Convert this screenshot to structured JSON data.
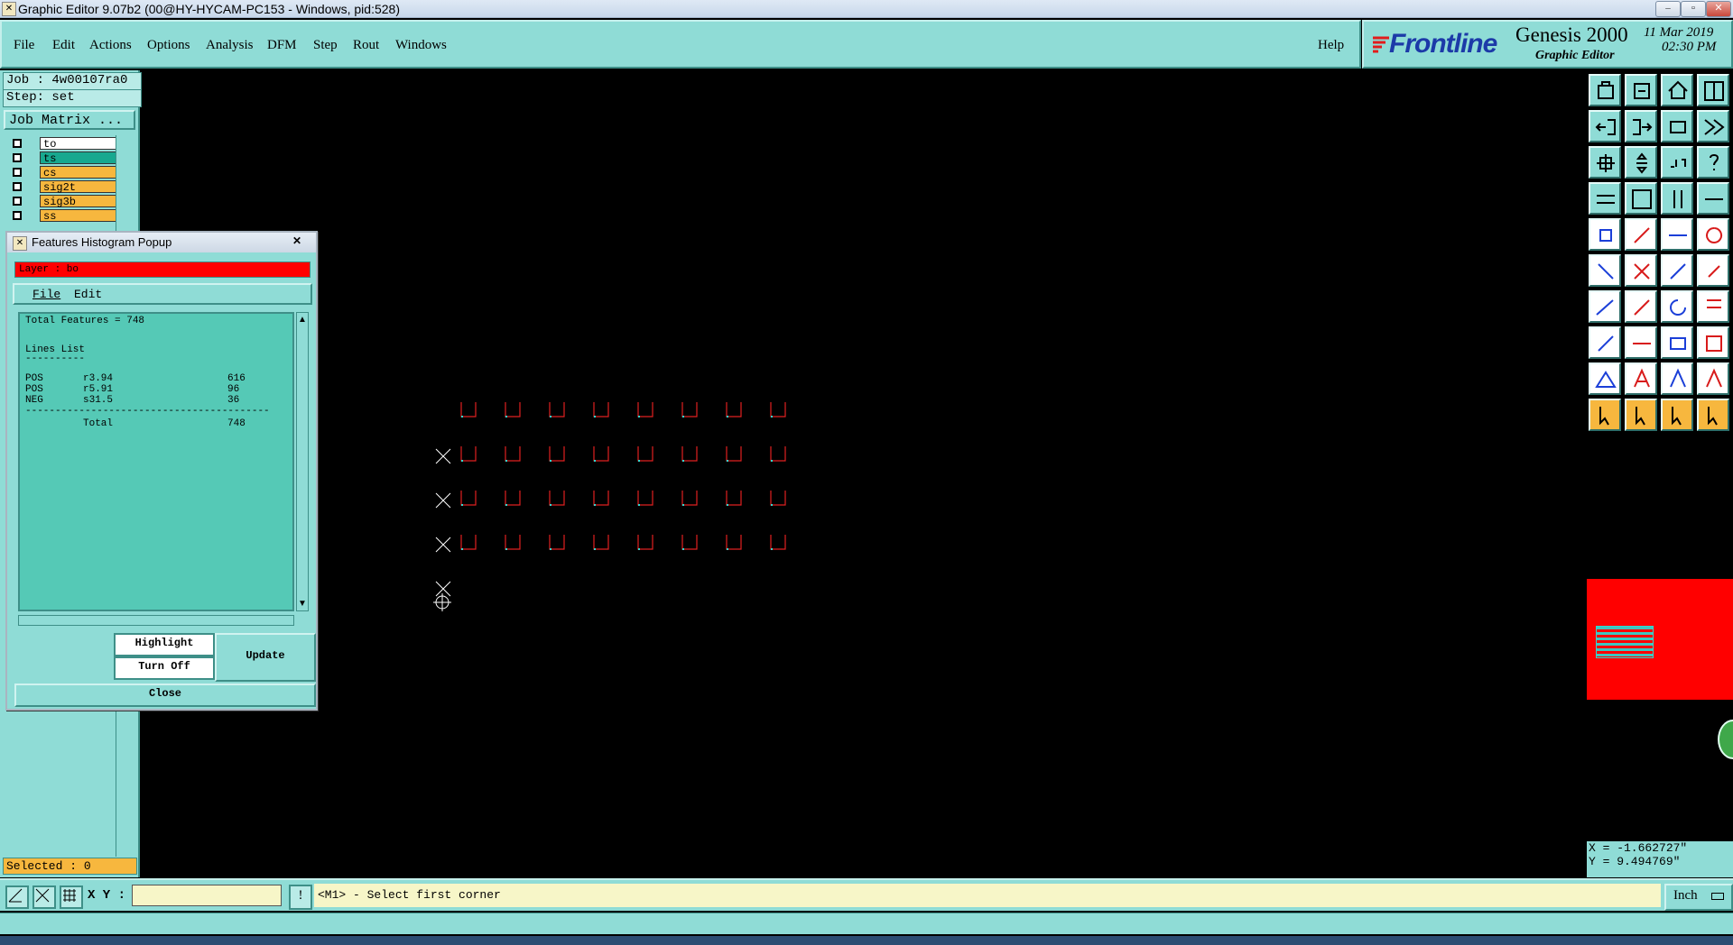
{
  "window": {
    "title": "Graphic Editor 9.07b2 (00@HY-HYCAM-PC153 - Windows, pid:528)"
  },
  "menubar": {
    "items": [
      {
        "label": "File",
        "name": "menu-file"
      },
      {
        "label": "Edit",
        "name": "menu-edit"
      },
      {
        "label": "Actions",
        "name": "menu-actions"
      },
      {
        "label": "Options",
        "name": "menu-options"
      },
      {
        "label": "Analysis",
        "name": "menu-analysis"
      },
      {
        "label": "DFM",
        "name": "menu-dfm"
      },
      {
        "label": "Step",
        "name": "menu-step"
      },
      {
        "label": "Rout",
        "name": "menu-rout"
      },
      {
        "label": "Windows",
        "name": "menu-windows"
      }
    ],
    "help_label": "Help"
  },
  "branding": {
    "logo_text": "Frontline",
    "product": "Genesis 2000",
    "subtitle": "Graphic Editor",
    "date": "11 Mar 2019",
    "time": "02:30 PM"
  },
  "left_panel": {
    "job": "Job : 4w00107ra0",
    "step": "Step: set",
    "job_matrix_label": "Job Matrix ...",
    "layers": [
      {
        "name": "to",
        "color": "#ffffff"
      },
      {
        "name": "ts",
        "color": "#17a88f"
      },
      {
        "name": "cs",
        "color": "#f7b73e"
      },
      {
        "name": "sig2t",
        "color": "#f7b73e"
      },
      {
        "name": "sig3b",
        "color": "#f7b73e"
      },
      {
        "name": "ss",
        "color": "#f7b73e"
      }
    ],
    "selected": "Selected : 0"
  },
  "popup": {
    "title": "Features Histogram Popup",
    "close_glyph": "✕",
    "layer_label": "Layer : bo",
    "menu_file": "File",
    "menu_edit": "Edit",
    "total_features": "Total Features = 748",
    "list_title": "Lines List",
    "list_underline": "----------",
    "rows": [
      {
        "pol": "POS",
        "sym": "r3.94",
        "count": "616"
      },
      {
        "pol": "POS",
        "sym": "r5.91",
        "count": "96"
      },
      {
        "pol": "NEG",
        "sym": "s31.5",
        "count": "36"
      }
    ],
    "separator": "------------------------------------------",
    "total_label": "Total",
    "total_count": "748",
    "highlight_label": "Highlight",
    "turnoff_label": "Turn Off",
    "update_label": "Update",
    "close_label": "Close"
  },
  "status": {
    "xy_label": "X Y :",
    "xy_value": "",
    "prompt": "<M1> - Select first corner",
    "units": "Inch",
    "coord_x": "X = -1.662727\"",
    "coord_y": "Y = 9.494769\""
  },
  "colors": {
    "panel": "#8fdcd6",
    "canvas": "#000000",
    "feature": "#e02020",
    "highlight": "#ff0000",
    "layer_bar": "#ff0000"
  }
}
